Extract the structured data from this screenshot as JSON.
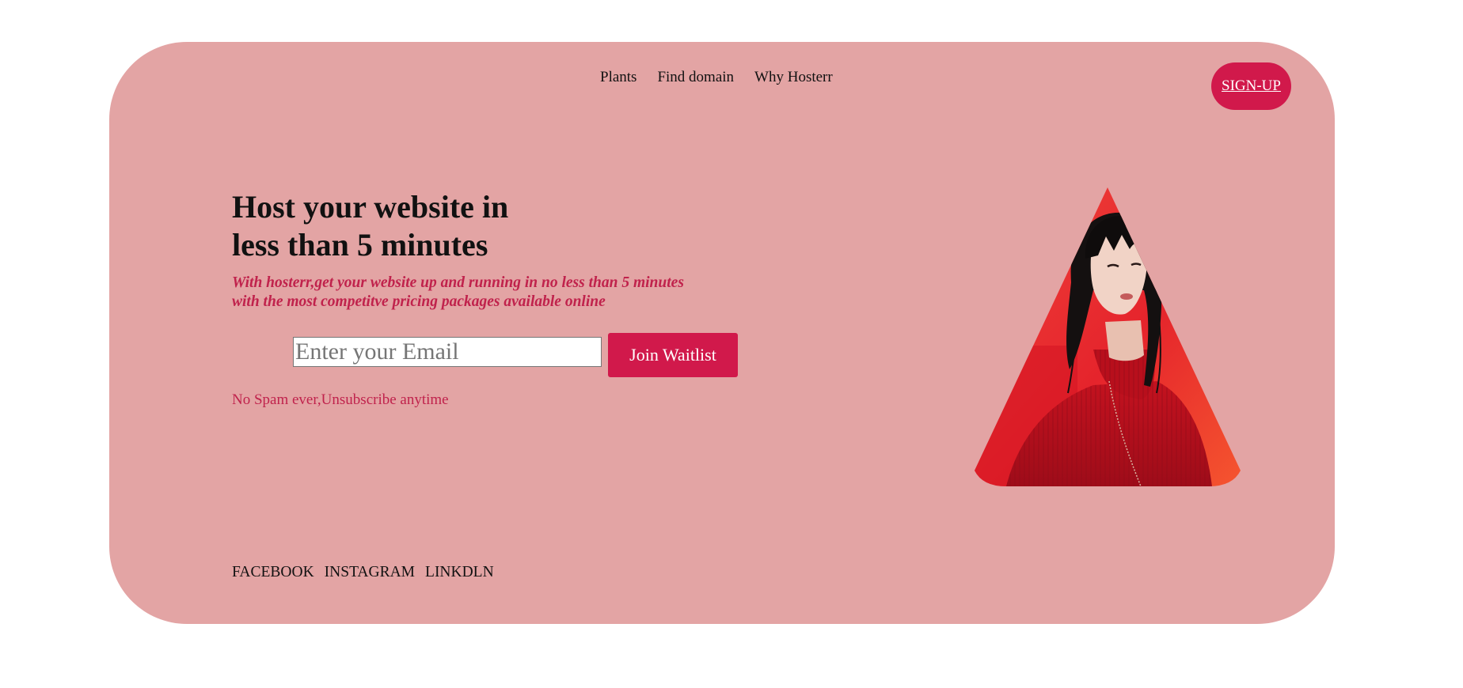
{
  "nav": {
    "links": [
      "Plants",
      "Find domain",
      "Why Hosterr"
    ],
    "signup_label": "SIGN-UP"
  },
  "hero": {
    "title_line1": "Host your website in",
    "title_line2": "less than 5 minutes",
    "subtitle_line1": "With hosterr,get your website up and running in no less than 5 minutes",
    "subtitle_line2": "with the most competitve pricing packages available online",
    "email_placeholder": "Enter your Email",
    "join_label": "Join Waitlist",
    "disclaimer": "No Spam ever,Unsubscribe anytime"
  },
  "social": {
    "links": [
      "FACEBOOK",
      "INSTAGRAM",
      "LINKDLN"
    ]
  },
  "colors": {
    "card_background": "#e3a4a4",
    "accent": "#d1194b",
    "subtitle_text": "#c0224c",
    "page_background": "#ffffff"
  },
  "image": {
    "subject": "woman-in-red-turtleneck-triangle-crop"
  }
}
